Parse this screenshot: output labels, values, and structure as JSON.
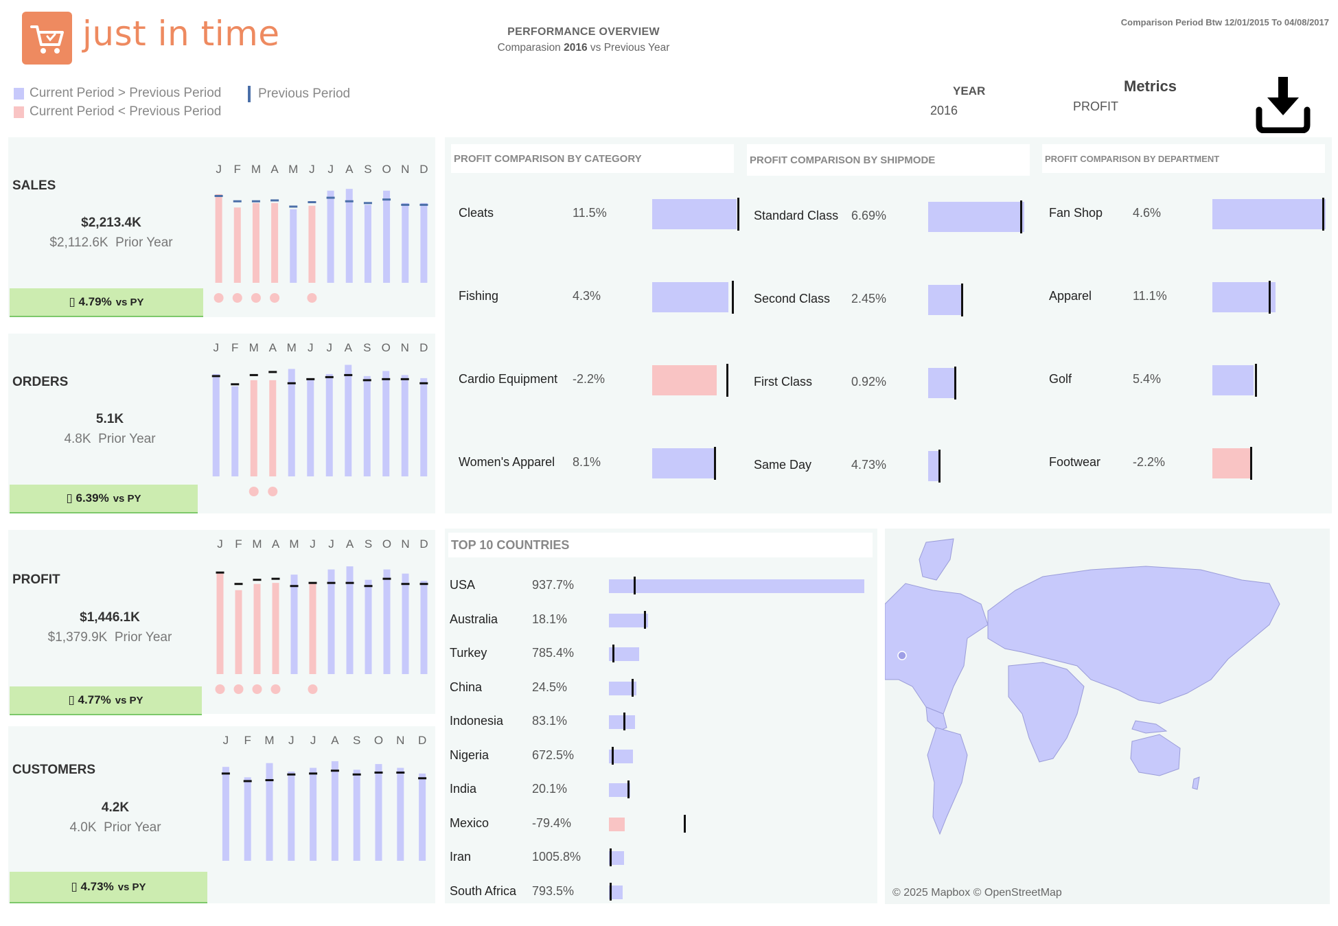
{
  "header": {
    "logo_text": "just in time",
    "overview_title": "PERFORMANCE OVERVIEW",
    "overview_sub_prefix": "Comparasion ",
    "overview_sub_year": "2016",
    "overview_sub_suffix": " vs Previous Year",
    "comparison_period": "Comparison Period Btw 12/01/2015 To 04/08/2017"
  },
  "legend": {
    "up": "Current Period > Previous Period",
    "down": "Current Period < Previous Period",
    "previous": "Previous Period"
  },
  "filters": {
    "year_label": "YEAR",
    "year_value": "2016",
    "metrics_label": "Metrics",
    "metrics_value": "PROFIT"
  },
  "colors": {
    "up": "#c7c9fb",
    "down": "#f9c4c4",
    "badge": "#ccecb0",
    "panel": "#f3f8f7",
    "marker": "#111111",
    "previous_marker": "#4b6fa8",
    "logo": "#ee8a60"
  },
  "kpis": [
    {
      "title": "SALES",
      "value": "$2,213.4K",
      "prior": "$2,112.6K",
      "prior_label": "Prior Year",
      "change": "4.79%",
      "vs": "vs PY",
      "chart_data": {
        "type": "bar",
        "categories": [
          "J",
          "F",
          "M",
          "A",
          "M",
          "J",
          "J",
          "A",
          "S",
          "O",
          "N",
          "D"
        ],
        "series": [
          {
            "values": [
              100,
              85,
              90,
              90,
              83,
              87,
              104,
              106,
              88,
              104,
              90,
              90
            ]
          }
        ],
        "previous": [
          98,
          92,
          92,
          93,
          86,
          91,
          96,
          92,
          90,
          94,
          88,
          88
        ],
        "down": [
          true,
          true,
          true,
          true,
          false,
          true,
          false,
          false,
          false,
          false,
          false,
          false
        ],
        "marker_color": "#4b6fa8"
      }
    },
    {
      "title": "ORDERS",
      "value": "5.1K",
      "prior": "4.8K",
      "prior_label": "Prior Year",
      "change": "6.39%",
      "vs": "vs PY",
      "chart_data": {
        "type": "bar",
        "categories": [
          "J",
          "F",
          "M",
          "A",
          "M",
          "J",
          "J",
          "A",
          "S",
          "O",
          "N",
          "D"
        ],
        "series": [
          {
            "values": [
              100,
              88,
              94,
              94,
              105,
              96,
              100,
              109,
              98,
              103,
              99,
              96
            ]
          }
        ],
        "previous": [
          98,
          90,
          99,
          102,
          91,
          95,
          97,
          99,
          94,
          95,
          95,
          91
        ],
        "down": [
          false,
          false,
          true,
          true,
          false,
          false,
          false,
          false,
          false,
          false,
          false,
          false
        ],
        "marker_color": "#111111"
      }
    },
    {
      "title": "PROFIT",
      "value": "$1,446.1K",
      "prior": "$1,379.9K",
      "prior_label": "Prior Year",
      "change": "4.77%",
      "vs": "vs PY",
      "chart_data": {
        "type": "bar",
        "categories": [
          "J",
          "F",
          "M",
          "A",
          "M",
          "J",
          "J",
          "A",
          "S",
          "O",
          "N",
          "D"
        ],
        "series": [
          {
            "values": [
              97,
              81,
              87,
              88,
              96,
              88,
              101,
              104,
              91,
              101,
              97,
              90
            ]
          }
        ],
        "previous": [
          98,
          87,
          91,
          92,
          85,
          88,
          88,
          88,
          85,
          92,
          87,
          87
        ],
        "down": [
          true,
          true,
          true,
          true,
          false,
          true,
          false,
          false,
          false,
          false,
          false,
          false
        ],
        "marker_color": "#111111"
      }
    },
    {
      "title": "CUSTOMERS",
      "value": "4.2K",
      "prior": "4.0K",
      "prior_label": "Prior Year",
      "change": "4.73%",
      "vs": "vs PY",
      "chart_data": {
        "type": "bar",
        "categories": [
          "J",
          "F",
          "M",
          "J",
          "J",
          "A",
          "S",
          "O",
          "N",
          "D"
        ],
        "series": [
          {
            "values": [
              99,
              88,
              103,
              94,
              98,
              105,
              96,
              102,
              98,
              92
            ]
          }
        ],
        "previous": [
          92,
          84,
          85,
          91,
          92,
          95,
          91,
          93,
          93,
          87
        ],
        "down": [
          false,
          false,
          false,
          false,
          false,
          false,
          false,
          false,
          false,
          false
        ],
        "marker_color": "#111111"
      }
    }
  ],
  "comparisons": [
    {
      "title": "PROFIT COMPARISON BY CATEGORY",
      "chart_data": {
        "type": "bar",
        "rows": [
          {
            "name": "Cleats",
            "pct": "11.5%",
            "value": 108,
            "previous": 110,
            "down": false
          },
          {
            "name": "Fishing",
            "pct": "4.3%",
            "value": 98,
            "previous": 103,
            "down": false
          },
          {
            "name": "Cardio Equipment",
            "pct": "-2.2%",
            "value": 83,
            "previous": 96,
            "down": true
          },
          {
            "name": "Women's Apparel",
            "pct": "8.1%",
            "value": 82,
            "previous": 80,
            "down": false
          }
        ]
      }
    },
    {
      "title": "PROFIT COMPARISON BY SHIPMODE",
      "chart_data": {
        "type": "bar",
        "rows": [
          {
            "name": "Standard Class",
            "pct": "6.69%",
            "value": 128,
            "previous": 123,
            "down": false
          },
          {
            "name": "Second Class",
            "pct": "2.45%",
            "value": 44,
            "previous": 45,
            "down": false
          },
          {
            "name": "First Class",
            "pct": "0.92%",
            "value": 35,
            "previous": 36,
            "down": false
          },
          {
            "name": "Same Day",
            "pct": "4.73%",
            "value": 14,
            "previous": 15,
            "down": false
          }
        ]
      }
    },
    {
      "title": "PROFIT COMPARISON BY DEPARTMENT",
      "chart_data": {
        "type": "bar",
        "rows": [
          {
            "name": "Fan Shop",
            "pct": "4.6%",
            "value": 164,
            "previous": 160,
            "down": false
          },
          {
            "name": "Apparel",
            "pct": "11.1%",
            "value": 91,
            "previous": 82,
            "down": false
          },
          {
            "name": "Golf",
            "pct": "5.4%",
            "value": 60,
            "previous": 63,
            "down": false
          },
          {
            "name": "Footwear",
            "pct": "-2.2%",
            "value": 55,
            "previous": 56,
            "down": true
          }
        ]
      }
    }
  ],
  "countries": {
    "title": "TOP 10 COUNTRIES",
    "chart_data": {
      "type": "bar",
      "rows": [
        {
          "name": "USA",
          "pct": "937.7%",
          "value": 372,
          "previous": 37,
          "down": false
        },
        {
          "name": "Australia",
          "pct": "18.1%",
          "value": 57,
          "previous": 52,
          "down": false
        },
        {
          "name": "Turkey",
          "pct": "785.4%",
          "value": 44,
          "previous": 6,
          "down": false
        },
        {
          "name": "China",
          "pct": "24.5%",
          "value": 40,
          "previous": 34,
          "down": false
        },
        {
          "name": "Indonesia",
          "pct": "83.1%",
          "value": 38,
          "previous": 22,
          "down": false
        },
        {
          "name": "Nigeria",
          "pct": "672.5%",
          "value": 35,
          "previous": 5,
          "down": false
        },
        {
          "name": "India",
          "pct": "20.1%",
          "value": 31,
          "previous": 28,
          "down": false
        },
        {
          "name": "Mexico",
          "pct": "-79.4%",
          "value": 23,
          "previous": 110,
          "down": true
        },
        {
          "name": "Iran",
          "pct": "1005.8%",
          "value": 22,
          "previous": 2,
          "down": false
        },
        {
          "name": "South Africa",
          "pct": "793.5%",
          "value": 20,
          "previous": 2,
          "down": false
        }
      ]
    }
  },
  "map": {
    "credit": "© 2025 Mapbox © OpenStreetMap"
  }
}
